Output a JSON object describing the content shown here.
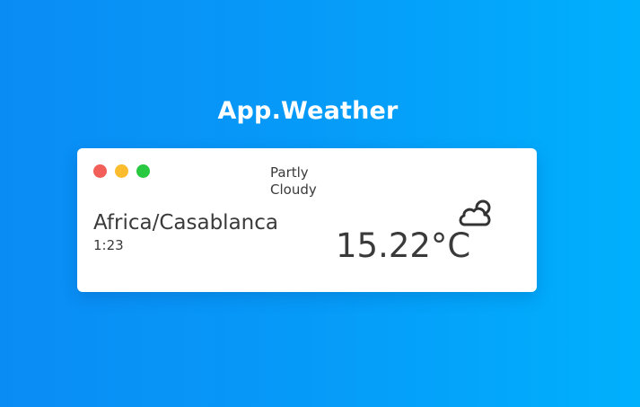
{
  "app": {
    "title": "App.Weather"
  },
  "window": {
    "controls": [
      {
        "name": "close",
        "color": "#f25f58"
      },
      {
        "name": "minimize",
        "color": "#fbbc2e"
      },
      {
        "name": "maximize",
        "color": "#28c840"
      }
    ]
  },
  "weather": {
    "condition_line1": "Partly",
    "condition_line2": "Cloudy",
    "location": "Africa/Casablanca",
    "time": "1:23",
    "temperature": "15.22°C",
    "icon": "partly-cloudy-icon"
  },
  "colors": {
    "background_start": "#0a8cf5",
    "background_end": "#00b0fd",
    "text": "#3a3a3a"
  }
}
